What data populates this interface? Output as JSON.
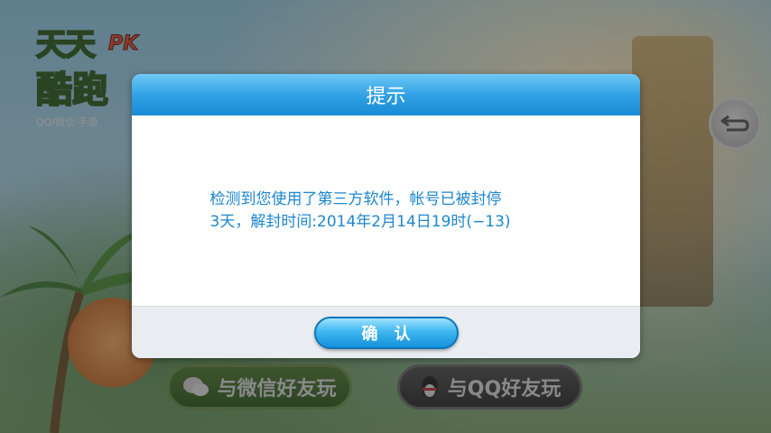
{
  "background": {
    "logo_top": "天天",
    "logo_pk": "PK",
    "logo_bottom": "酷跑",
    "logo_sub": "QQ/微信·手游"
  },
  "buttons": {
    "wechat_label": "与微信好友玩",
    "qq_label": "与QQ好友玩"
  },
  "dialog": {
    "title": "提示",
    "message_line1": "检测到您使用了第三方软件，帐号已被封停",
    "message_line2": "3天，解封时间:2014年2月14日19时(−13)",
    "confirm_label": "确认"
  },
  "colors": {
    "header_blue": "#2d9fe3",
    "message_text": "#1d86cf",
    "footer_gray": "#e9ecf0"
  },
  "icons": [
    "back-arrow-icon",
    "wechat-icon",
    "qq-penguin-icon"
  ]
}
